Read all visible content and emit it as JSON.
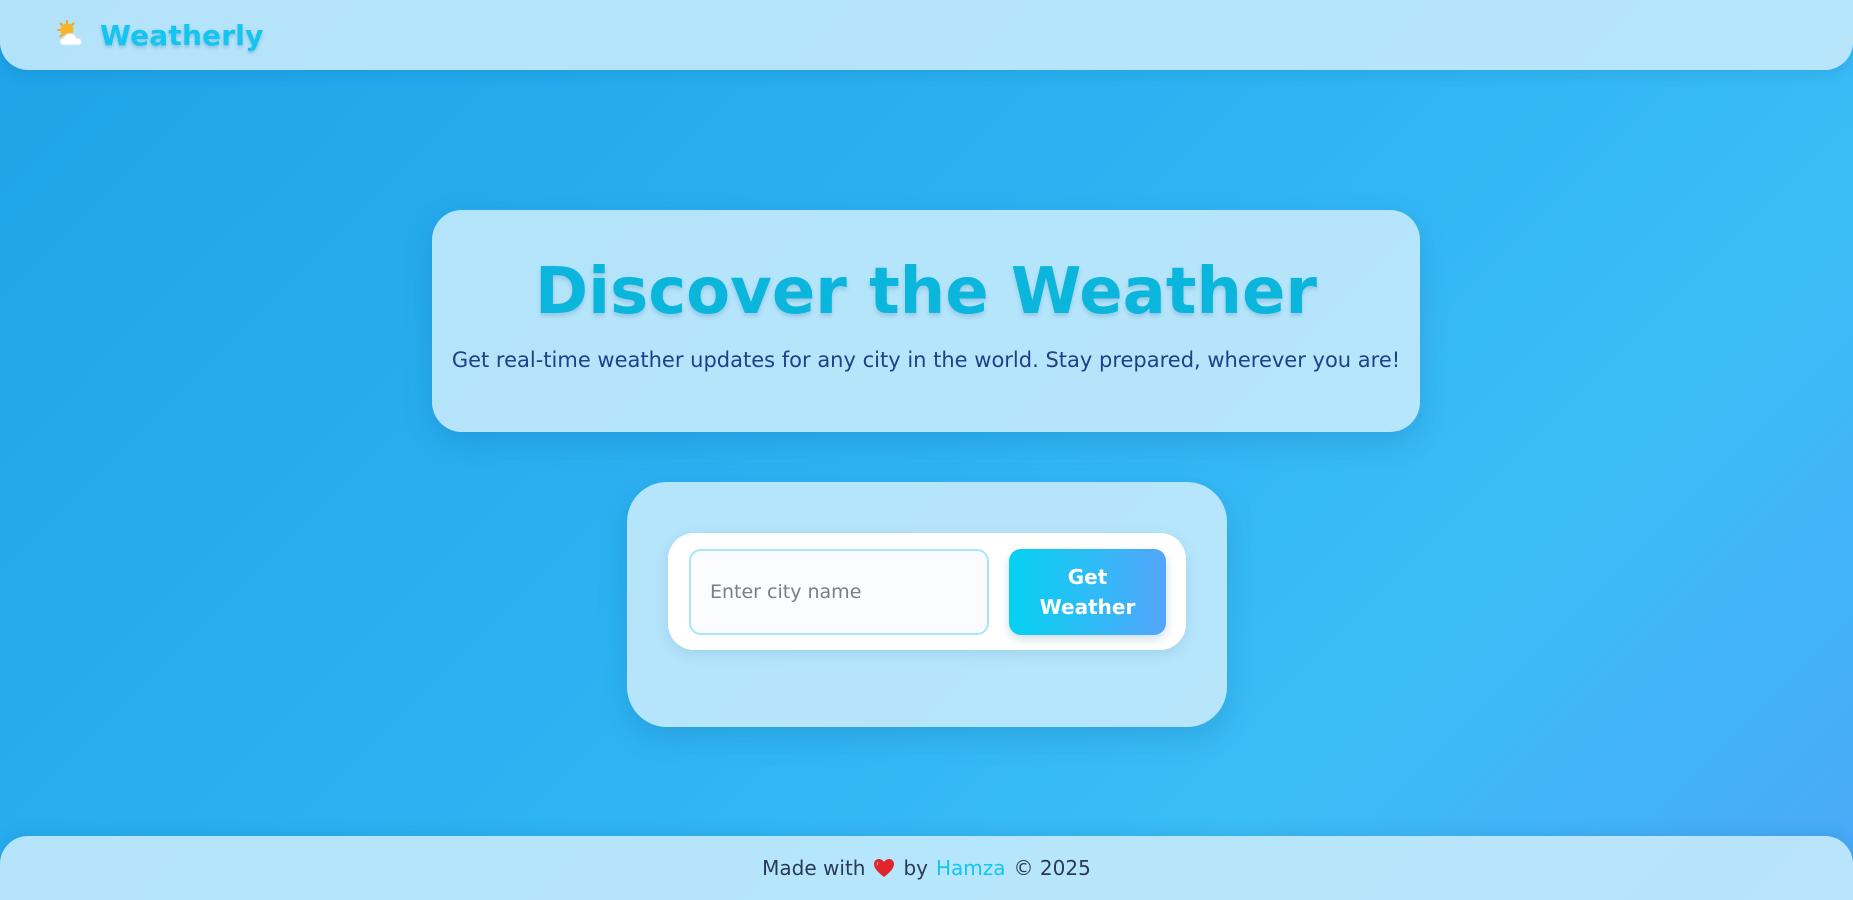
{
  "navbar": {
    "logo_icon": "sun-behind-cloud-icon",
    "brand_name": "Weatherly"
  },
  "hero": {
    "title": "Discover the Weather",
    "subtitle": "Get real-time weather updates for any city in the world. Stay prepared, wherever you are!"
  },
  "search": {
    "input_placeholder": "Enter city name",
    "input_value": "",
    "button_label": "Get Weather"
  },
  "footer": {
    "made_with": "Made with",
    "heart_icon": "heart-icon",
    "by": "by",
    "author": "Hamza",
    "copyright": "© 2025"
  },
  "colors": {
    "accent": "#12c6ef",
    "title": "#0bb6dc",
    "subtitle": "#20408a",
    "background": "#2cb2f2",
    "button_gradient_start": "#05d1f1",
    "button_gradient_end": "#54a4fa"
  }
}
